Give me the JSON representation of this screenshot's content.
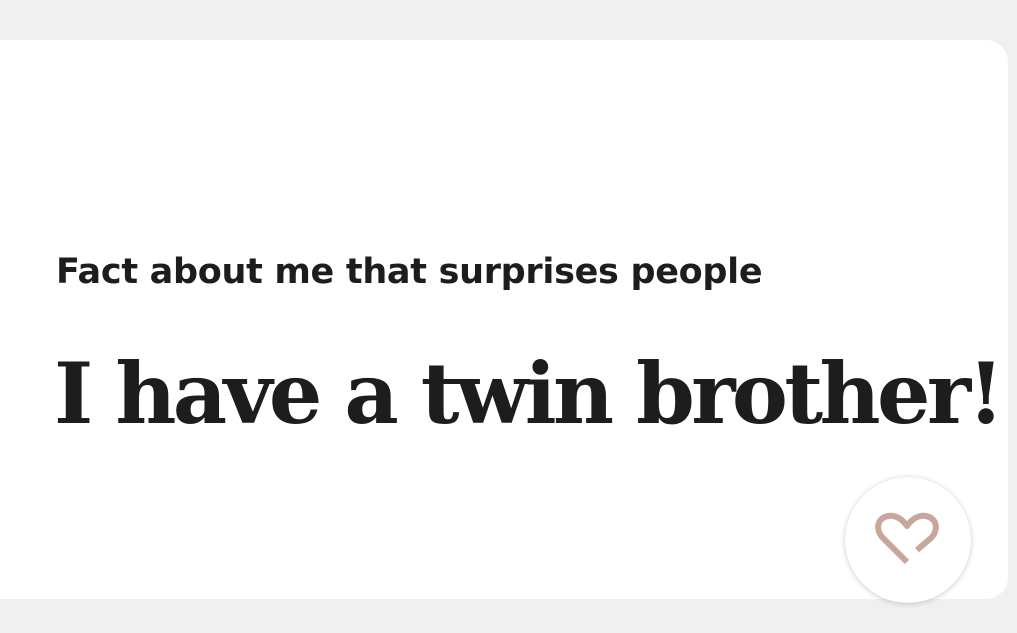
{
  "prompt_card": {
    "prompt": "Fact about me that surprises people",
    "answer": "I have a twin brother!",
    "like_button": {
      "icon": "heart-outline-icon",
      "icon_color": "#c7a79c"
    }
  },
  "colors": {
    "page_background": "#f0f0f0",
    "card_background": "#ffffff",
    "text": "#1d1d1d"
  }
}
